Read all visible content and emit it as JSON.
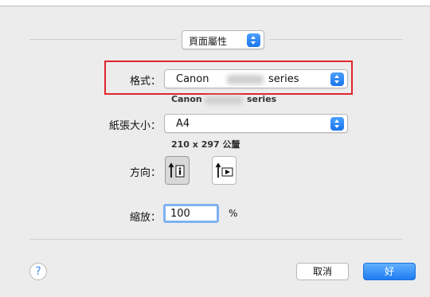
{
  "section": {
    "value": "頁面屬性"
  },
  "format": {
    "label": "格式：",
    "value_left": "Canon",
    "value_right": "series",
    "sub_left": "Canon",
    "sub_right": "series"
  },
  "paper": {
    "label": "紙張大小：",
    "value": "A4",
    "dimensions": "210 x 297 公釐"
  },
  "orientation": {
    "label": "方向：",
    "options": [
      "portrait",
      "landscape"
    ],
    "selected": "portrait"
  },
  "scale": {
    "label": "縮放：",
    "value": "100",
    "unit": "%"
  },
  "help": {
    "glyph": "?"
  },
  "buttons": {
    "cancel": "取消",
    "ok": "好"
  },
  "colors": {
    "accent": "#1a73ee",
    "highlight": "#e0262e",
    "focus_ring": "#7fb2f1"
  }
}
